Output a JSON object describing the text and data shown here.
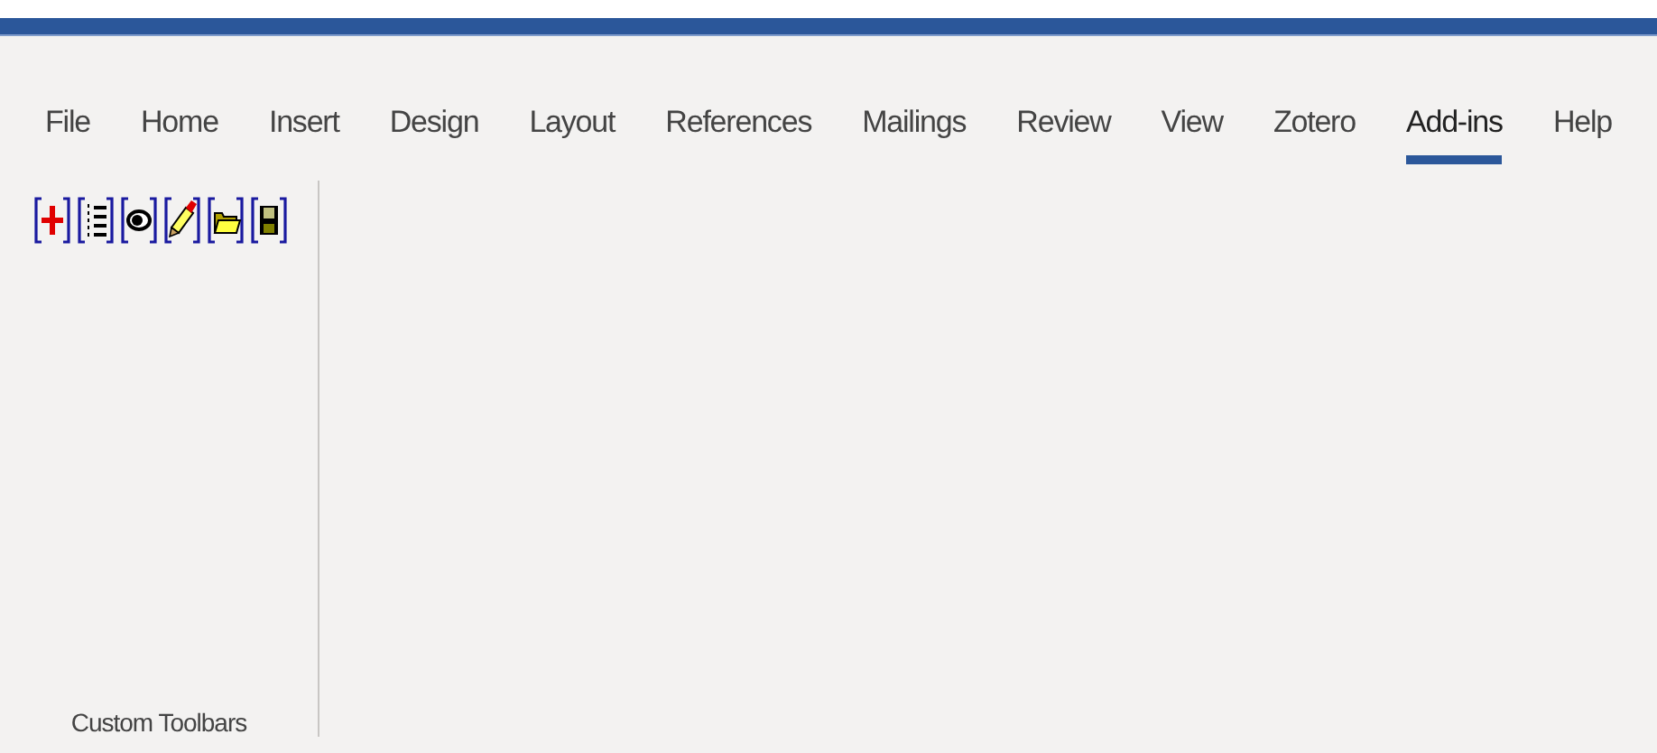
{
  "tabs": [
    {
      "label": "File",
      "selected": false
    },
    {
      "label": "Home",
      "selected": false
    },
    {
      "label": "Insert",
      "selected": false
    },
    {
      "label": "Design",
      "selected": false
    },
    {
      "label": "Layout",
      "selected": false
    },
    {
      "label": "References",
      "selected": false
    },
    {
      "label": "Mailings",
      "selected": false
    },
    {
      "label": "Review",
      "selected": false
    },
    {
      "label": "View",
      "selected": false
    },
    {
      "label": "Zotero",
      "selected": false
    },
    {
      "label": "Add-ins",
      "selected": true
    },
    {
      "label": "Help",
      "selected": false
    }
  ],
  "ribbon_group": {
    "label": "Custom Toolbars",
    "buttons": [
      {
        "kind": "plus"
      },
      {
        "kind": "list"
      },
      {
        "kind": "eye"
      },
      {
        "kind": "pencil"
      },
      {
        "kind": "folder"
      },
      {
        "kind": "disk"
      }
    ]
  }
}
